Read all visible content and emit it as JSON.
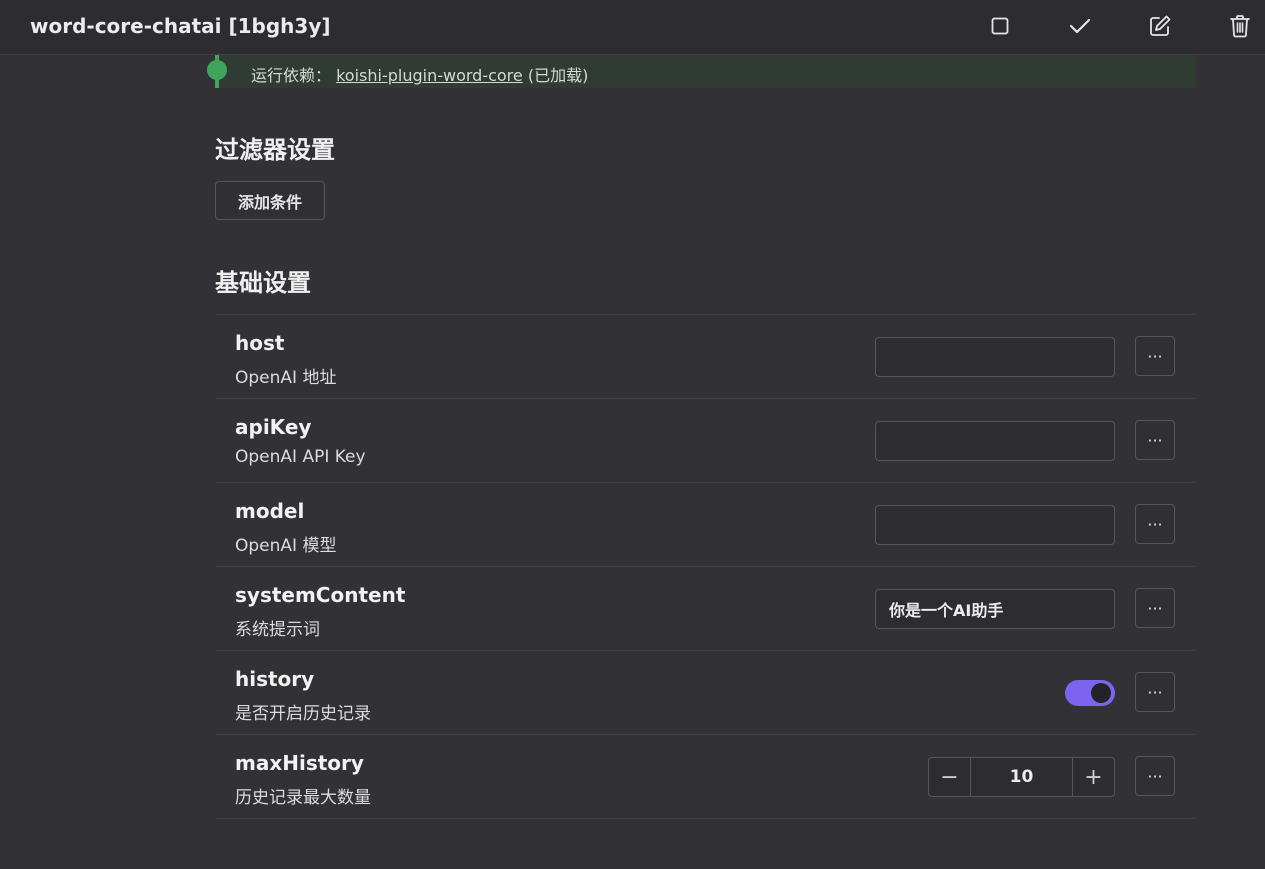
{
  "header": {
    "title": "word-core-chatai [1bgh3y]",
    "icons": [
      "square-icon",
      "check-icon",
      "edit-icon",
      "trash-icon"
    ]
  },
  "notice": {
    "text": "运行依赖：",
    "link": "koishi-plugin-word-core",
    "suffix": "(已加载)",
    "color": "#3fa55c"
  },
  "filter_section": {
    "title": "过滤器设置",
    "add_condition_label": "添加条件"
  },
  "basic_section": {
    "title": "基础设置",
    "rows": [
      {
        "name": "host",
        "desc": "OpenAI 地址",
        "value": "",
        "more": "···"
      },
      {
        "name": "apiKey",
        "desc": "OpenAI API Key",
        "value": "",
        "more": "···"
      },
      {
        "name": "model",
        "desc": "OpenAI 模型",
        "value": "",
        "more": "···"
      },
      {
        "name": "systemContent",
        "desc": "系统提示词",
        "value": "你是一个AI助手",
        "more": "···"
      },
      {
        "name": "history",
        "desc": "是否开启历史记录",
        "enabled": true,
        "more": "···"
      },
      {
        "name": "maxHistory",
        "desc": "历史记录最大数量",
        "value": "10",
        "minus": "−",
        "plus": "+",
        "more": "···"
      }
    ]
  },
  "colors": {
    "background": "#313136",
    "toggle_on": "#7c64f0",
    "notice_accent": "#3fa55c"
  }
}
